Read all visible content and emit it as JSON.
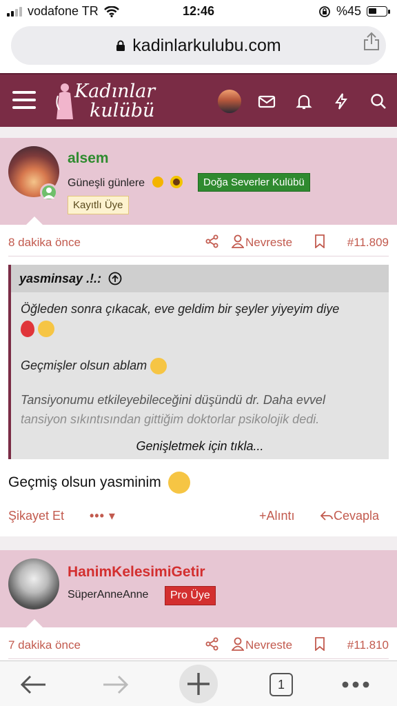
{
  "status_bar": {
    "carrier": "vodafone TR",
    "time": "12:46",
    "battery": "%45"
  },
  "browser": {
    "url": "kadinlarkulubu.com"
  },
  "site": {
    "logo_line1": "Kadınlar",
    "logo_line2": "kulübü"
  },
  "posts": [
    {
      "username": "alsem",
      "username_color": "#2e8b2e",
      "user_title": "Güneşli günlere",
      "club_badge": "Doğa Severler Kulübü",
      "member_badge": "Kayıtlı Üye",
      "time_ago": "8 dakika önce",
      "nevreste": "Nevreste",
      "post_number": "#11.809",
      "quote": {
        "author": "yasminsay .!.:",
        "line1": "Öğleden sonra çıkacak, eve geldim bir şeyler yiyeyim diye",
        "line2": "Geçmişler olsun ablam",
        "line3": "Tansiyonumu etkileyebileceğini düşündü dr. Daha evvel",
        "line4": "tansiyon sıkıntısından gittiğim doktorlar psikolojik dedi.",
        "expand": "Genişletmek için tıkla..."
      },
      "reply_text": "Geçmiş olsun yasminim",
      "actions": {
        "report": "Şikayet Et",
        "quote": "Alıntı",
        "reply": "Cevapla"
      }
    },
    {
      "username": "HanimKelesimiGetir",
      "username_color": "#d32f2f",
      "user_title": "SüperAnneAnne",
      "member_badge": "Pro Üye",
      "time_ago": "7 dakika önce",
      "nevreste": "Nevreste",
      "post_number": "#11.810"
    }
  ],
  "toolbar": {
    "tabs_count": "1"
  }
}
